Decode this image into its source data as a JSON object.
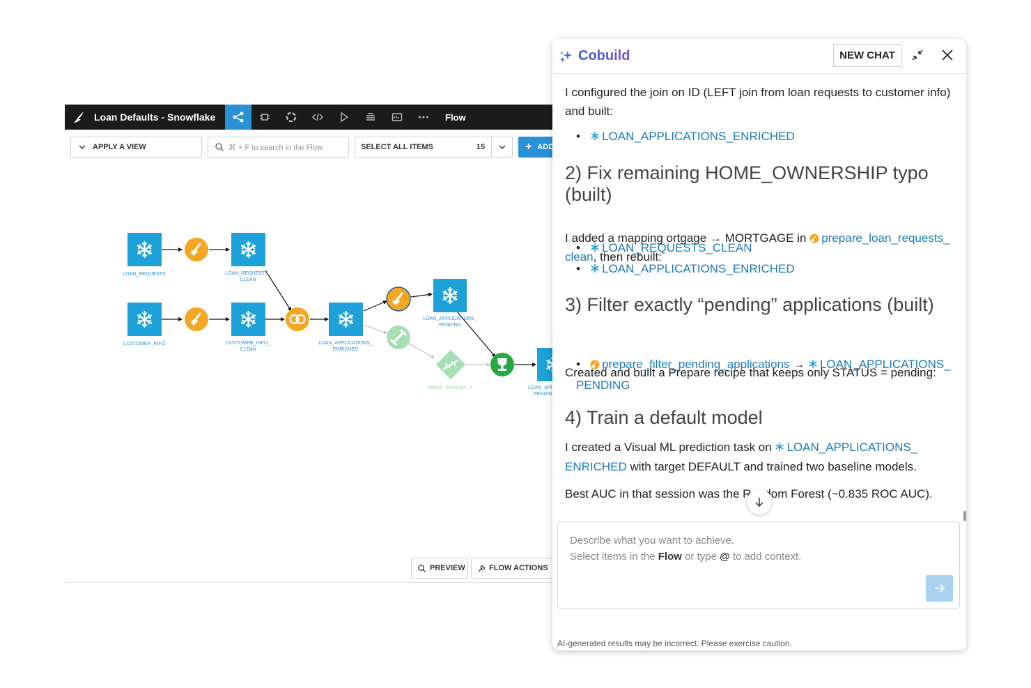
{
  "flow": {
    "project_title": "Loan Defaults - Snowflake",
    "active_tab": "Flow",
    "toolbar": {
      "apply_view": "APPLY A VIEW",
      "search_placeholder": "⌘ + F to search in the Flow",
      "select_all": "SELECT ALL ITEMS",
      "select_count": "15",
      "add_label": "ADD"
    },
    "nodes": {
      "loan_requests": "LOAN_REQUESTS",
      "loan_requests_clean_1": "LOAN_REQUESTS_",
      "loan_requests_clean_2": "CLEAN",
      "customer_info": "CUSTOMER_INFO",
      "customer_info_clean_1": "CUSTOMER_INFO_",
      "customer_info_clean_2": "CLEAN",
      "loan_apps_enriched_1": "LOAN_APPLICATIONS_",
      "loan_apps_enriched_2": "ENRICHED",
      "loan_apps_pending_1": "LOAN_APPLICATIONS_",
      "loan_apps_pending_2": "PENDING",
      "default_prediction": "default_prediction_rf",
      "loan_apps_pending_b_1": "LOAN_APP",
      "loan_apps_pending_b_2": "PENDIN"
    },
    "bottom": {
      "preview": "PREVIEW",
      "flow_actions": "FLOW ACTIONS"
    },
    "colors": {
      "dataset": "#1ea0d9",
      "recipe": "#f5a623",
      "join": "#f5a623",
      "model": "#27a844",
      "ghost": "#a6dfb4",
      "topbar": "#1b1b1b",
      "accent": "#2b91d5"
    }
  },
  "cobuild": {
    "title": "Cobuild",
    "new_chat": "NEW CHAT",
    "messages": {
      "intro_1": "I configured the join on ID (LEFT join from loan requests to customer info)",
      "intro_2": "and built:",
      "built_1": "LOAN_APPLICATIONS_ENRICHED",
      "h_fix": "2) Fix remaining HOME_OWNERSHIP typo (built)",
      "fix_text_a": "I added a mapping ortgage → MORTGAGE in",
      "fix_link_a": "prepare_loan_requests_",
      "fix_link_b": "clean",
      "fix_text_b": ", then rebuilt:",
      "fix_b1": "LOAN_REQUESTS_CLEAN",
      "fix_b2": "LOAN_APPLICATIONS_ENRICHED",
      "h_filter": "3) Filter exactly “pending” applications (built)",
      "filter_text": "Created and built a Prepare recipe that keeps only STATUS = pending:",
      "filter_recipe": "prepare_filter_pending_applications",
      "filter_arrow": "→",
      "filter_out_a": "LOAN_APPLICATIONS_",
      "filter_out_b": "PENDING",
      "h_train": "4) Train a default model",
      "train_text_a": "I created a Visual ML prediction task on",
      "train_link_a": "LOAN_APPLICATIONS_",
      "train_link_b": "ENRICHED",
      "train_text_b": " with target DEFAULT and trained two baseline models.",
      "auc_text": "Best AUC in that session was the Random Forest (~0.835 ROC AUC)."
    },
    "input": {
      "line1": "Describe what you want to achieve.",
      "line2_a": "Select items in the ",
      "line2_b": "Flow",
      "line2_c": " or type ",
      "line2_d": "@",
      "line2_e": " to add context."
    },
    "disclaimer": "AI-generated results may be incorrect. Please exercise caution."
  }
}
